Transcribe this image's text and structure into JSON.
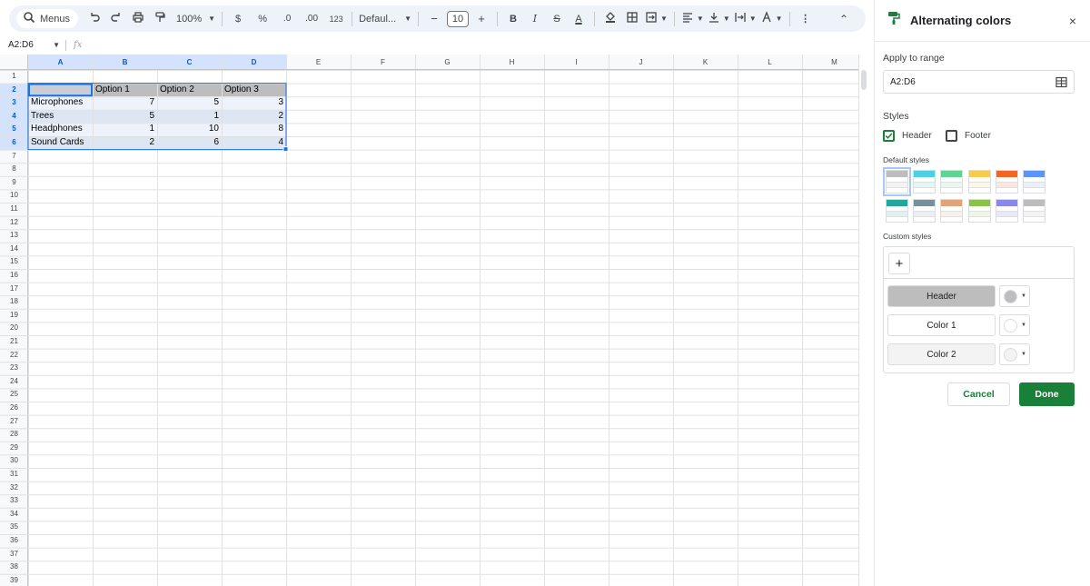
{
  "toolbar": {
    "menus_label": "Menus",
    "zoom": "100%",
    "currency_symbol": "$",
    "percent_symbol": "%",
    "decrease_decimal": ".0",
    "increase_decimal": ".00",
    "number_format": "123",
    "font_family": "Defaul...",
    "font_size": "10",
    "minus": "−",
    "plus": "+",
    "bold": "B",
    "italic": "I",
    "strike": "S",
    "text_color": "A",
    "more": "⋮",
    "collapse": "⌃"
  },
  "formula_bar": {
    "name_box": "A2:D6",
    "fx": "fx"
  },
  "sheet": {
    "columns": [
      "A",
      "B",
      "C",
      "D",
      "E",
      "F",
      "G",
      "H",
      "I",
      "J",
      "K",
      "L",
      "M"
    ],
    "rows": [
      "1",
      "2",
      "3",
      "4",
      "5",
      "6",
      "7",
      "8",
      "9",
      "10",
      "11",
      "12",
      "13",
      "14",
      "15",
      "16",
      "17",
      "18",
      "19",
      "20",
      "21",
      "22",
      "23",
      "24",
      "25",
      "26",
      "27",
      "28",
      "29",
      "30",
      "31",
      "32",
      "33",
      "34",
      "35",
      "36",
      "37",
      "38",
      "39"
    ],
    "header_row": [
      "",
      "Option 1",
      "Option 2",
      "Option 3"
    ],
    "data_rows": [
      [
        "Microphones",
        "7",
        "5",
        "3"
      ],
      [
        "Trees",
        "5",
        "1",
        "2"
      ],
      [
        "Headphones",
        "1",
        "10",
        "8"
      ],
      [
        "Sound Cards",
        "2",
        "6",
        "4"
      ]
    ]
  },
  "panel": {
    "title": "Alternating colors",
    "close": "×",
    "apply_to_range_label": "Apply to range",
    "range_value": "A2:D6",
    "styles_label": "Styles",
    "header_checkbox": {
      "label": "Header",
      "checked": true
    },
    "footer_checkbox": {
      "label": "Footer",
      "checked": false
    },
    "default_styles_label": "Default styles",
    "default_styles": [
      {
        "header": "#bdbdbd",
        "stripe": "#f3f3f3"
      },
      {
        "header": "#4dd0e1",
        "stripe": "#e0f7fa"
      },
      {
        "header": "#63d297",
        "stripe": "#e7f9ef"
      },
      {
        "header": "#f7cb4d",
        "stripe": "#fef8e3"
      },
      {
        "header": "#f46524",
        "stripe": "#ffe6dd"
      },
      {
        "header": "#5b95f9",
        "stripe": "#e8f0fe"
      },
      {
        "header": "#26a69a",
        "stripe": "#ddf2f0"
      },
      {
        "header": "#78909c",
        "stripe": "#ebeff1"
      },
      {
        "header": "#e0a47b",
        "stripe": "#fbf0e9"
      },
      {
        "header": "#8bc34a",
        "stripe": "#eef7e3"
      },
      {
        "header": "#8989eb",
        "stripe": "#e8e7fc"
      },
      {
        "header": "#bdbdbd",
        "stripe": "#f3f3f3"
      }
    ],
    "custom_styles_label": "Custom styles",
    "add_style": "+",
    "custom_rows": [
      {
        "label": "Header",
        "button_bg": "#bdbdbd",
        "dot": "#bdbdbd"
      },
      {
        "label": "Color 1",
        "button_bg": "#ffffff",
        "dot": "#ffffff"
      },
      {
        "label": "Color 2",
        "button_bg": "#f3f3f3",
        "dot": "#f3f3f3"
      }
    ],
    "cancel_label": "Cancel",
    "done_label": "Done"
  },
  "colors": {
    "accent_green": "#188038",
    "selection_blue": "#1a73e8",
    "selection_fill": "#e8eef8",
    "table_header": "#bdbdbd",
    "stripe": "#f3f3f3"
  }
}
